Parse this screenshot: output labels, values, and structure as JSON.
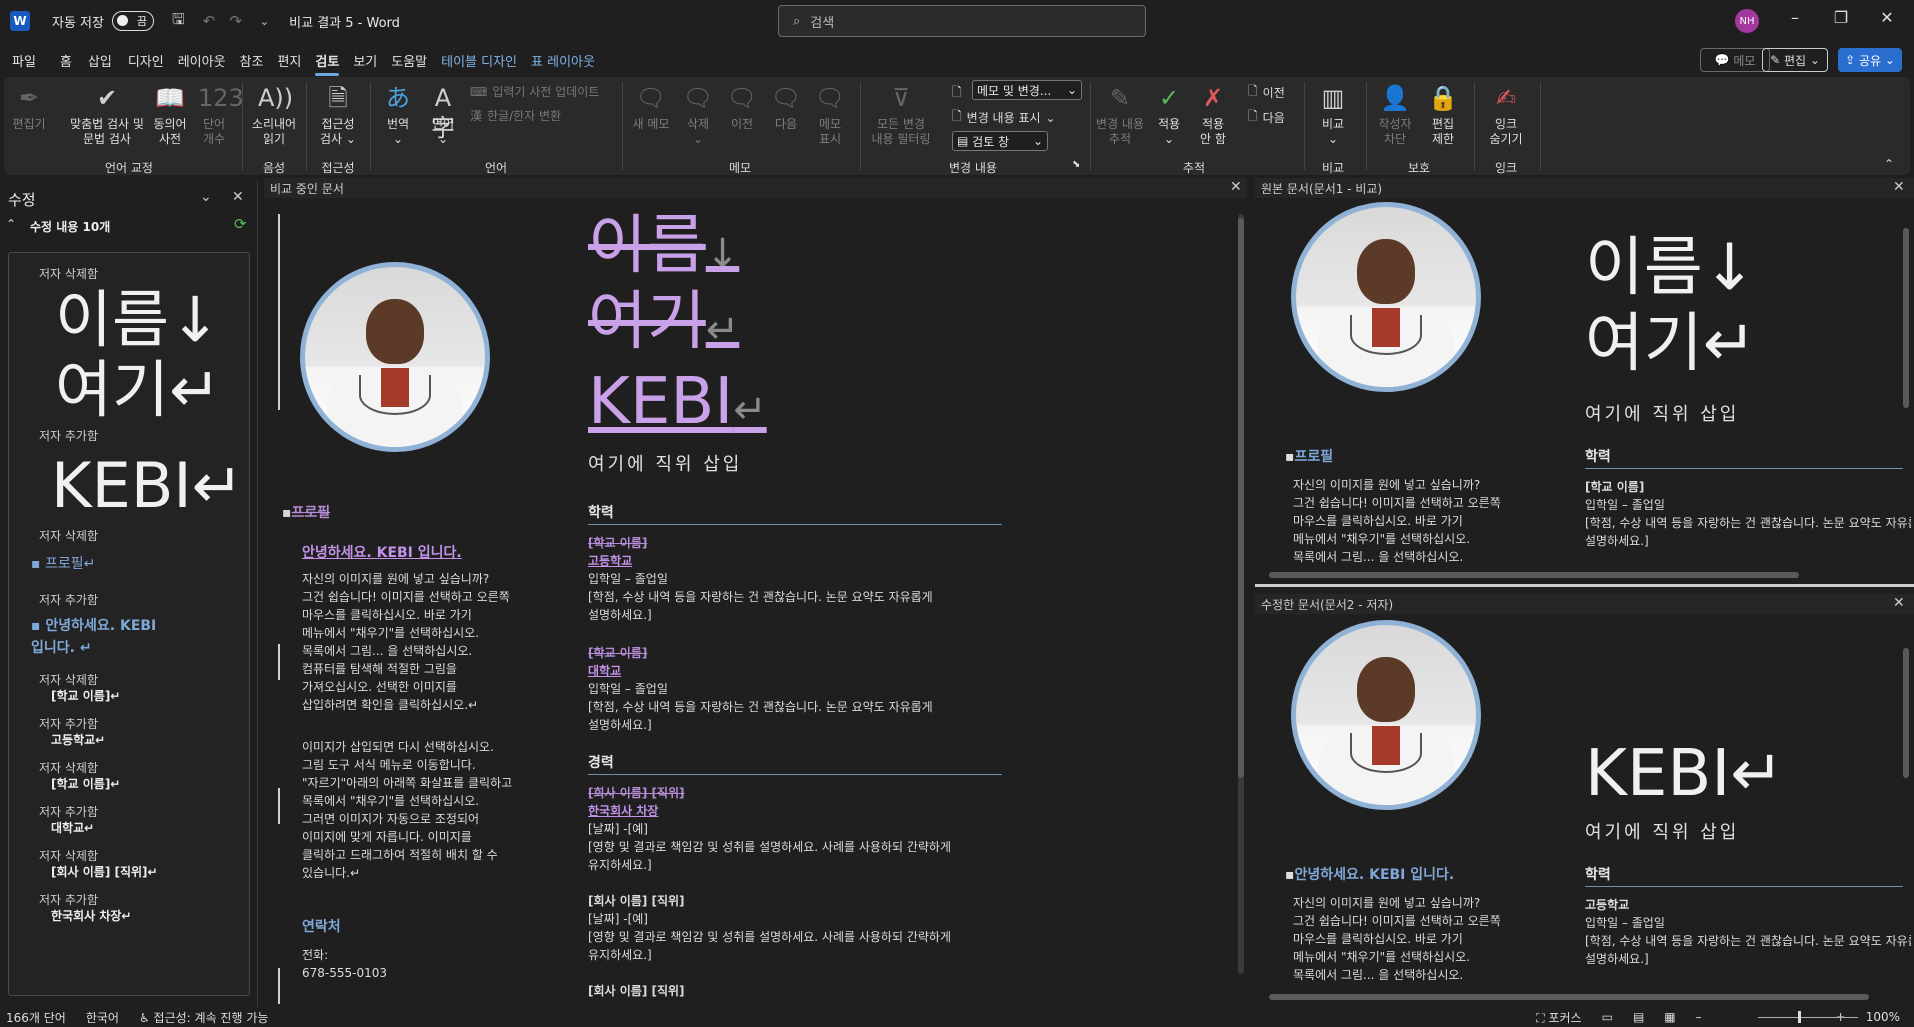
{
  "titlebar": {
    "autosave_label": "자동 저장",
    "autosave_state": "끔",
    "doc_title": "비교 결과 5  -  Word",
    "search_placeholder": "검색",
    "avatar_initials": "NH"
  },
  "menu": [
    "파일",
    "홈",
    "삽입",
    "디자인",
    "레이아웃",
    "참조",
    "편지",
    "검토",
    "보기",
    "도움말",
    "테이블 디자인",
    "표 레이아웃"
  ],
  "menu_active": "검토",
  "right_buttons": {
    "memo": "메모",
    "edit": "편집",
    "share": "공유"
  },
  "ribbon": {
    "groups": {
      "proofing": "언어 교정",
      "voice": "음성",
      "access": "접근성",
      "language": "언어",
      "memo": "메모",
      "changes": "변경 내용",
      "tracking": "추적",
      "compare": "비교",
      "protect": "보호",
      "ink": "잉크"
    },
    "buttons": {
      "editor": "편집기",
      "spelling": "맞춤법 검사 및\n문법 검사",
      "thesaurus": "동의어\n사전",
      "wordcount": "단어\n개수",
      "readaloud": "소리내어\n읽기",
      "checkaccess": "접근성\n검사",
      "translate": "번역",
      "language": "언어",
      "ime_update": "입력기 사전 업데이트",
      "hanja": "한글/한자 변환",
      "new_memo": "새 메모",
      "delete": "삭제",
      "prev": "이전",
      "next": "다음",
      "show_memo": "메모\n표시",
      "all_changes": "모든 변경\n내용 필터링",
      "markup_dd": "메모 및 변경...",
      "show_markup": "변경 내용 표시",
      "review_pane": "검토 창",
      "track_changes": "변경 내용\n추적",
      "accept": "적용",
      "reject": "적용\n안 함",
      "prev_change": "이전",
      "next_change": "다음",
      "compare": "비교",
      "block_authors": "작성자\n차단",
      "restrict": "편집\n제한",
      "hide_ink": "잉크\n숨기기"
    }
  },
  "revision_pane": {
    "title": "수정",
    "count_label": "수정 내용 10개",
    "items": [
      {
        "author": "저자 삭제함",
        "text": "이름↓\n여기↵"
      },
      {
        "author": "저자 추가함",
        "text": "KEBI↵"
      },
      {
        "author": "저자 삭제함",
        "text": "프로필↵"
      },
      {
        "author": "저자 추가함",
        "text": "안녕하세요. KEBI\n입니다. ↵"
      },
      {
        "author": "저자 삭제함",
        "text": "[학교 이름]↵"
      },
      {
        "author": "저자 추가함",
        "text": "고등학교↵"
      },
      {
        "author": "저자 삭제함",
        "text": "[학교 이름]↵"
      },
      {
        "author": "저자 추가함",
        "text": "대학교↵"
      },
      {
        "author": "저자 삭제함",
        "text": "[회사 이름] [직위]↵"
      },
      {
        "author": "저자 추가함",
        "text": "한국회사 차장↵"
      }
    ]
  },
  "compared_doc": {
    "header": "비교 중인 문서",
    "name_del_1": "이름",
    "name_del_2": "여기",
    "name_ins": "KEBI",
    "job_title": "여기에 직위 삽입",
    "profile_del": "프로필",
    "hello_ins": "안녕하세요. KEBI 입니다.",
    "intro": "자신의 이미지를 원에 넣고 싶습니까?\n그건 쉽습니다! 이미지를 선택하고 오른쪽\n마우스를 클릭하십시오. 바로 가기\n메뉴에서 \"채우기\"를 선택하십시오.\n목록에서 그림... 을 선택하십시오.\n컴퓨터를 탐색해 적절한 그림을\n가져오십시오. 선택한 이미지를\n삽입하려면 확인을 클릭하십시오.↵",
    "intro2": "이미지가 삽입되면 다시 선택하십시오.\n그림 도구 서식 메뉴로 이동합니다.\n\"자르기\"아래의 아래쪽 화살표를 클릭하고\n목록에서 \"채우기\"를 선택하십시오.\n그러면 이미지가 자동으로 조정되어\n이미지에 맞게 자릅니다. 이미지를\n클릭하고 드래그하여 적절히 배치 할 수\n있습니다.↵",
    "contact_head": "연락처",
    "phone_label": "전화:",
    "phone": "678-555-0103",
    "edu_head": "학력",
    "school1_del": "[학교 이름]",
    "school1_ins": "고등학교",
    "dates": "입학일 – 졸업일",
    "edu_desc": "[학점, 수상 내역 등을 자랑하는 건 괜찮습니다. 논문 요약도 자유롭게\n설명하세요.]",
    "school2_del": "[학교 이름]",
    "school2_ins": "대학교",
    "exp_head": "경력",
    "company1_del": "[회사 이름] [직위]",
    "company1_ins": "한국회사 차장",
    "date_range": "[날짜] -[예]",
    "exp_desc": "[영향 및 결과로 책임감 및 성취를 설명하세요. 사례를 사용하되 간략하게\n유지하세요.]",
    "company2": "[회사 이름] [직위]",
    "company3": "[회사 이름] [직위]"
  },
  "original_doc": {
    "header": "원본 문서(문서1 - 비교)",
    "name": "이름↓\n여기↵",
    "job_title": "여기에 직위 삽입",
    "profile": "프로필",
    "intro": "자신의 이미지를 원에 넣고 싶습니까?\n그건 쉽습니다! 이미지를 선택하고 오른쪽\n마우스를 클릭하십시오. 바로 가기\n메뉴에서 \"채우기\"를 선택하십시오.\n목록에서 그림... 을 선택하십시오.",
    "edu_head": "학력",
    "school": "[학교 이름]",
    "dates": "입학일 – 졸업일",
    "edu_desc": "[학점, 수상 내역 등을 자랑하는 건 괜찮습니다. 논문 요약도 자유롭게\n설명하세요.]"
  },
  "revised_doc": {
    "header": "수정한 문서(문서2 - 저자)",
    "name": "KEBI↵",
    "job_title": "여기에 직위 삽입",
    "hello": "안녕하세요. KEBI 입니다.",
    "intro": "자신의 이미지를 원에 넣고 싶습니까?\n그건 쉽습니다! 이미지를 선택하고 오른쪽\n마우스를 클릭하십시오. 바로 가기\n메뉴에서 \"채우기\"를 선택하십시오.\n목록에서 그림... 을 선택하십시오.",
    "edu_head": "학력",
    "school": "고등학교",
    "dates": "입학일 – 졸업일",
    "edu_desc": "[학점, 수상 내역 등을 자랑하는 건 괜찮습니다. 논문 요약도 자유롭게\n설명하세요.]"
  },
  "statusbar": {
    "words": "166개 단어",
    "language": "한국어",
    "accessibility": "접근성: 계속 진행 가능",
    "focus": "포커스",
    "zoom": "100%"
  },
  "colors": {
    "accent": "#6fa8dc",
    "revision": "#c9a1e8",
    "profile_blue": "#7fa8d8"
  }
}
